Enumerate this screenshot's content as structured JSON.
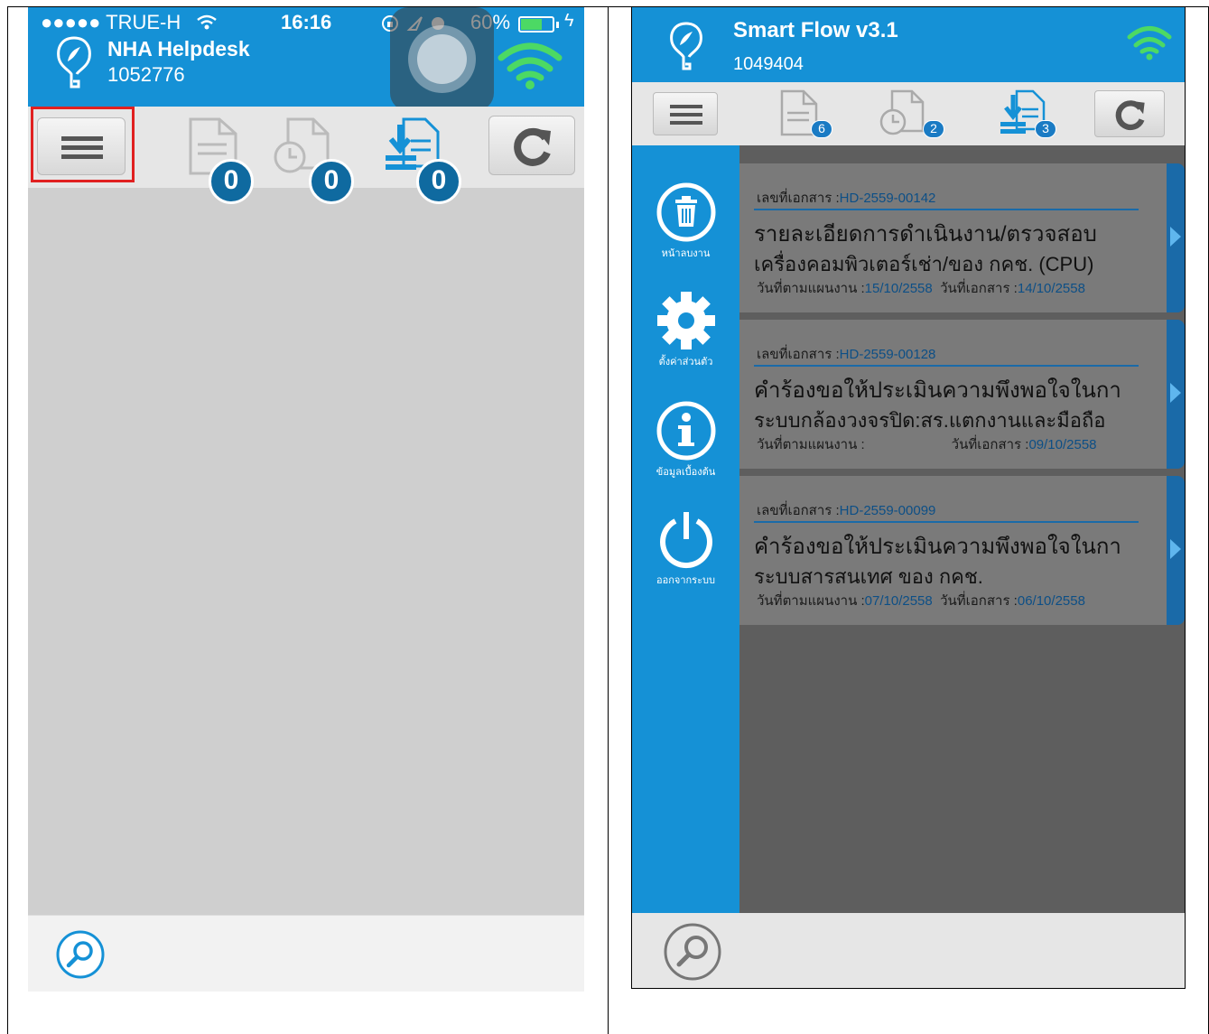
{
  "left_app": {
    "status": {
      "carrier": "●●●●● TRUE-H",
      "time": "16:16",
      "battery": "60%"
    },
    "title": "NHA Helpdesk",
    "user_id": "1052776",
    "toolbar": {
      "badges": [
        "0",
        "0",
        "0"
      ]
    }
  },
  "right_app": {
    "title": "Smart Flow v3.1",
    "user_id": "1049404",
    "toolbar": {
      "badges": [
        "6",
        "2",
        "3"
      ]
    },
    "sidebar": [
      {
        "label": "หน้าลบงาน",
        "icon": "trash-icon"
      },
      {
        "label": "ตั้งค่าส่วนตัว",
        "icon": "gear-icon"
      },
      {
        "label": "ข้อมูลเบื้องต้น",
        "icon": "info-icon"
      },
      {
        "label": "ออกจากระบบ",
        "icon": "power-icon"
      }
    ],
    "cards": [
      {
        "doc_label": "เลขที่เอกสาร :",
        "doc_no": "HD-2559-00142",
        "line1": "รายละเอียดการดำเนินงาน/ตรวจสอบ",
        "line2": "เครื่องคอมพิวเตอร์เช่า/ของ กคช. (CPU)",
        "plan_label": "วันที่ตามแผนงาน :",
        "plan_date": "15/10/2558",
        "doc_date_label": "วันที่เอกสาร :",
        "doc_date": "14/10/2558"
      },
      {
        "doc_label": "เลขที่เอกสาร :",
        "doc_no": "HD-2559-00128",
        "line1": "คำร้องขอให้ประเมินความพึงพอใจในกา",
        "line2": "ระบบกล้องวงจรปิด:สร.แตกงานและมือถือ",
        "plan_label": "วันที่ตามแผนงาน :",
        "plan_date": "",
        "doc_date_label": "วันที่เอกสาร :",
        "doc_date": "09/10/2558"
      },
      {
        "doc_label": "เลขที่เอกสาร :",
        "doc_no": "HD-2559-00099",
        "line1": "คำร้องขอให้ประเมินความพึงพอใจในกา",
        "line2": "ระบบสารสนเทศ ของ กคช.",
        "plan_label": "วันที่ตามแผนงาน :",
        "plan_date": "07/10/2558",
        "doc_date_label": "วันที่เอกสาร :",
        "doc_date": "06/10/2558"
      }
    ]
  },
  "colors": {
    "brand_blue": "#1591d6",
    "highlight_red": "#e02020",
    "wifi_green": "#4cd964"
  }
}
